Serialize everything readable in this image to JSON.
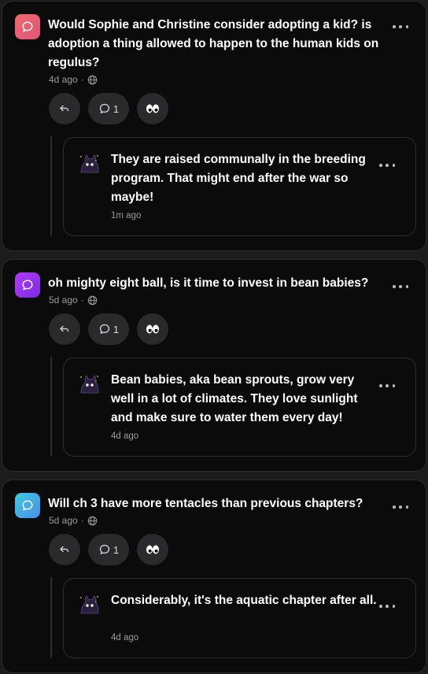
{
  "posts": [
    {
      "question": "Would Sophie and Christine consider adopting a kid? is adoption a thing allowed to happen to the human kids on regulus?",
      "time": "4d ago",
      "visibility_icon": "globe-icon",
      "comment_count": "1",
      "avatar_gradient": [
        "#f06a6a",
        "#e0537a"
      ],
      "reply": {
        "text": "They are raised communally in the breeding program. That might end after the war so maybe!",
        "time": "1m ago"
      }
    },
    {
      "question": "oh mighty eight ball, is it time to invest in bean babies?",
      "time": "5d ago",
      "visibility_icon": "globe-icon",
      "comment_count": "1",
      "avatar_gradient": [
        "#b13cf0",
        "#7d2ae8"
      ],
      "reply": {
        "text": "Bean babies, aka bean sprouts, grow very well in a lot of climates. They love sunlight and make sure to water them every day!",
        "time": "4d ago"
      }
    },
    {
      "question": "Will ch 3 have more tentacles than previous chapters?",
      "time": "5d ago",
      "visibility_icon": "globe-icon",
      "comment_count": "1",
      "avatar_gradient": [
        "#3fc8e0",
        "#4a8ee8"
      ],
      "reply": {
        "text": "Considerably, it's the aquatic chapter after all.",
        "time": "4d ago"
      }
    }
  ],
  "colors": {
    "card_bg": "#0b0b0c",
    "pill_bg": "#2a2a2c",
    "muted_text": "#9a9a9a"
  }
}
